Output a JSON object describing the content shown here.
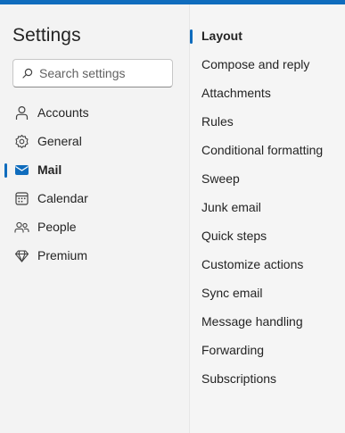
{
  "settings": {
    "title": "Settings",
    "search_placeholder": "Search settings"
  },
  "nav": [
    {
      "label": "Accounts",
      "icon": "person-icon",
      "active": false
    },
    {
      "label": "General",
      "icon": "gear-icon",
      "active": false
    },
    {
      "label": "Mail",
      "icon": "mail-icon",
      "active": true
    },
    {
      "label": "Calendar",
      "icon": "calendar-icon",
      "active": false
    },
    {
      "label": "People",
      "icon": "people-icon",
      "active": false
    },
    {
      "label": "Premium",
      "icon": "diamond-icon",
      "active": false
    }
  ],
  "mail_sections": [
    {
      "label": "Layout",
      "active": true
    },
    {
      "label": "Compose and reply",
      "active": false
    },
    {
      "label": "Attachments",
      "active": false
    },
    {
      "label": "Rules",
      "active": false
    },
    {
      "label": "Conditional formatting",
      "active": false
    },
    {
      "label": "Sweep",
      "active": false
    },
    {
      "label": "Junk email",
      "active": false
    },
    {
      "label": "Quick steps",
      "active": false
    },
    {
      "label": "Customize actions",
      "active": false
    },
    {
      "label": "Sync email",
      "active": false
    },
    {
      "label": "Message handling",
      "active": false
    },
    {
      "label": "Forwarding",
      "active": false
    },
    {
      "label": "Subscriptions",
      "active": false
    }
  ],
  "colors": {
    "accent": "#0f6cbd",
    "pane_background": "#f3f3f3"
  }
}
